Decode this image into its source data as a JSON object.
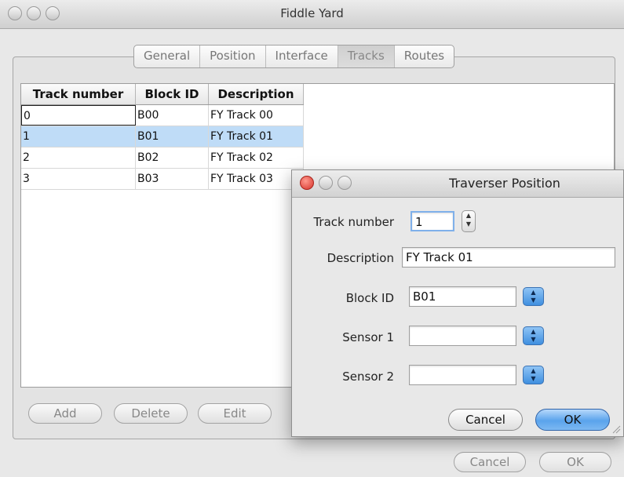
{
  "window": {
    "title": "Fiddle Yard",
    "tabs": [
      {
        "label": "General"
      },
      {
        "label": "Position"
      },
      {
        "label": "Interface"
      },
      {
        "label": "Tracks"
      },
      {
        "label": "Routes"
      }
    ],
    "selected_tab": "Tracks"
  },
  "table": {
    "columns": [
      "Track number",
      "Block ID",
      "Description"
    ],
    "rows": [
      {
        "track": "0",
        "block": "B00",
        "desc": "FY Track 00"
      },
      {
        "track": "1",
        "block": "B01",
        "desc": "FY Track 01"
      },
      {
        "track": "2",
        "block": "B02",
        "desc": "FY Track 02"
      },
      {
        "track": "3",
        "block": "B03",
        "desc": "FY Track 03"
      }
    ],
    "selected_row": 1
  },
  "table_buttons": {
    "add": "Add",
    "delete": "Delete",
    "edit": "Edit"
  },
  "window_buttons": {
    "cancel": "Cancel",
    "ok": "OK"
  },
  "dialog": {
    "title": "Traverser Position",
    "track_number_label": "Track number",
    "track_number_value": "1",
    "description_label": "Description",
    "description_value": "FY Track 01",
    "block_id_label": "Block ID",
    "block_id_value": "B01",
    "sensor1_label": "Sensor 1",
    "sensor1_value": "",
    "sensor2_label": "Sensor 2",
    "sensor2_value": "",
    "cancel": "Cancel",
    "ok": "OK"
  },
  "colors": {
    "selection": "#bfdcf7",
    "default_button": "#5aa3ec",
    "close_button": "#e0443a"
  }
}
